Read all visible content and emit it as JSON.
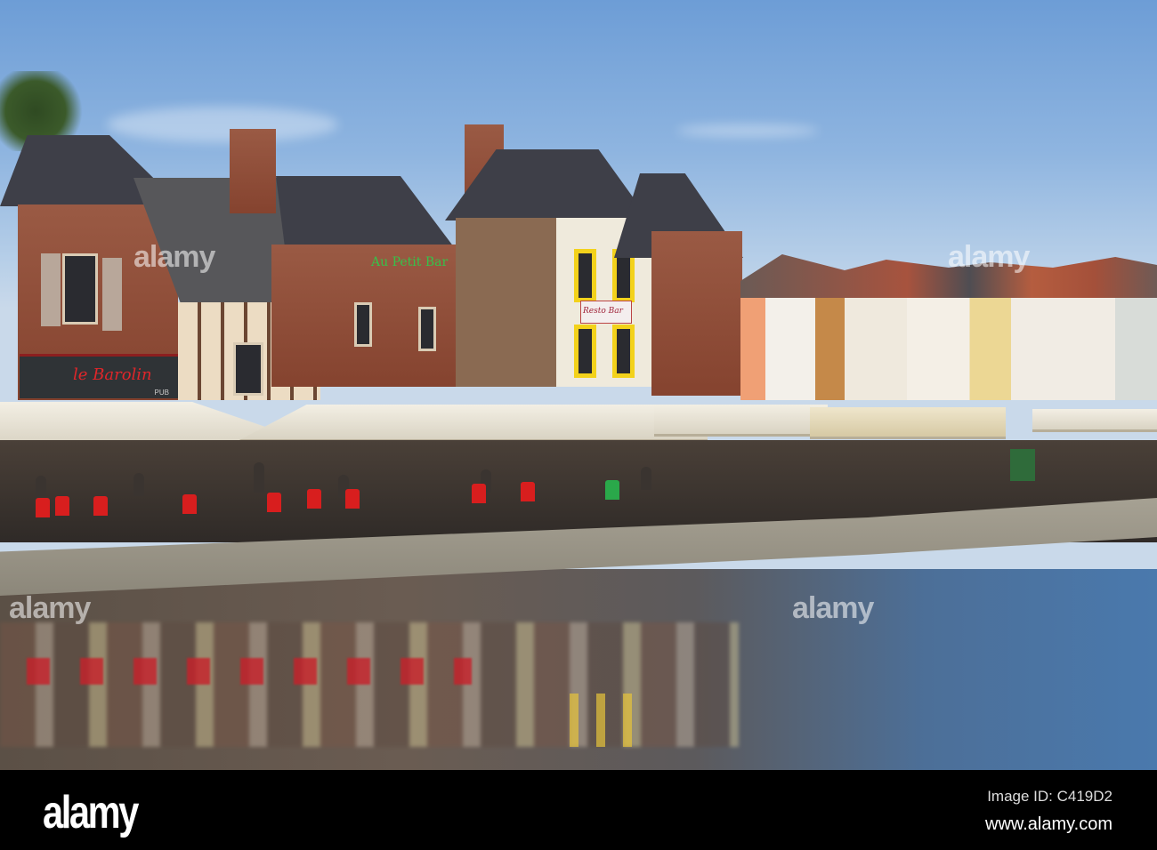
{
  "photo": {
    "signs": {
      "bar_left": "le Barolin",
      "pub": "PUB",
      "green_sign": "Au Petit Bar",
      "resto": "Resto Bar"
    },
    "watermark": "alamy",
    "colors": {
      "sky": "#8fb5e0",
      "brick": "#8e4b36",
      "awning": "#ece7da",
      "chairs": "#d81e1e",
      "water": "#4a79ad"
    }
  },
  "footer": {
    "logo": "alamy",
    "image_id": "Image ID: C419D2",
    "website": "www.alamy.com"
  }
}
